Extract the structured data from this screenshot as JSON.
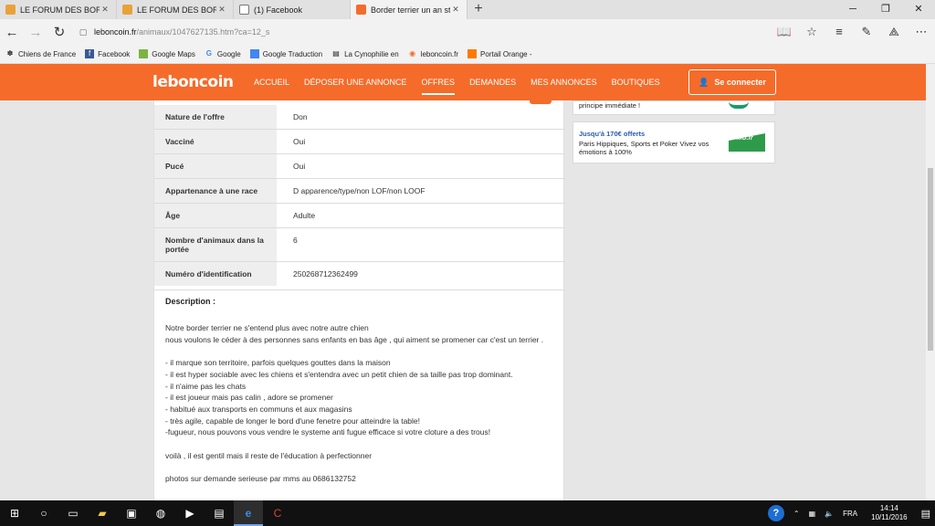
{
  "browser": {
    "tabs": [
      {
        "title": "LE FORUM DES BORDER TE",
        "icon": "forum-icon",
        "active": false
      },
      {
        "title": "LE FORUM DES BORDER TE",
        "icon": "forum-icon",
        "active": false
      },
      {
        "title": "(1) Facebook",
        "icon": "page-icon",
        "active": false
      },
      {
        "title": "Border terrier un an ster",
        "icon": "leboncoin-icon",
        "active": true
      }
    ],
    "url_host": "leboncoin.fr",
    "url_path": "/animaux/1047627135.htm?ca=12_s",
    "favorites": [
      {
        "label": "Chiens de France",
        "icon": "paw-icon"
      },
      {
        "label": "Facebook",
        "icon": "facebook-icon"
      },
      {
        "label": "Google Maps",
        "icon": "maps-icon"
      },
      {
        "label": "Google",
        "icon": "google-icon"
      },
      {
        "label": "Google Traduction",
        "icon": "translate-icon"
      },
      {
        "label": "La Cynophilie en",
        "icon": "page-icon"
      },
      {
        "label": "leboncoin.fr",
        "icon": "leboncoin-icon"
      },
      {
        "label": "Portail Orange -",
        "icon": "orange-icon"
      }
    ]
  },
  "site": {
    "logo": "leboncoin",
    "nav": [
      "ACCUEIL",
      "DÉPOSER UNE ANNONCE",
      "OFFRES",
      "DEMANDES",
      "MES ANNONCES",
      "BOUTIQUES"
    ],
    "active_nav": "OFFRES",
    "connect_label": "Se connecter"
  },
  "criteria": [
    {
      "label": "Nature de l'offre",
      "value": "Don"
    },
    {
      "label": "Vacciné",
      "value": "Oui"
    },
    {
      "label": "Pucé",
      "value": "Oui"
    },
    {
      "label": "Appartenance à une race",
      "value": "D apparence/type/non LOF/non LOOF"
    },
    {
      "label": "Âge",
      "value": "Adulte"
    },
    {
      "label": "Nombre d'animaux dans la portée",
      "value": "6"
    },
    {
      "label": "Numéro d'identification",
      "value": "250268712362499"
    }
  ],
  "description": {
    "title": "Description :",
    "lines": [
      "Notre border terrier ne s'entend plus avec notre autre chien",
      "nous voulons le céder à des personnes sans enfants en bas âge , qui aiment se promener car c'est un terrier .",
      "",
      "- il marque son territoire, parfois quelques gouttes dans la maison",
      "- il est hyper sociable avec les chiens et s'entendra avec un petit chien de sa taille pas trop dominant.",
      "- il n'aime pas les chats",
      "- il est joueur mais pas calin , adore se promener",
      "- habitué aux transports en communs et aux magasins",
      "- très agile, capable de longer le bord d'une fenetre pour atteindre la table!",
      "-fugueur, nous pouvons vous vendre le systeme anti fugue efficace si votre cloture a des trous!",
      "",
      "voilà , il est gentil mais il reste de l'éducation à perfectionner",
      "",
      "photos sur demande serieuse par mms au 0686132752"
    ]
  },
  "ads": {
    "ad1_text": "principe immédiate !",
    "ad2_title": "Jusqu'à 170€ offerts",
    "ad2_body": "Paris Hippiques, Sports et Poker Vivez vos émotions à 100%",
    "ad2_logo": "PMU.fr"
  },
  "taskbar": {
    "language": "FRA",
    "time": "14:14",
    "date": "10/11/2016"
  }
}
